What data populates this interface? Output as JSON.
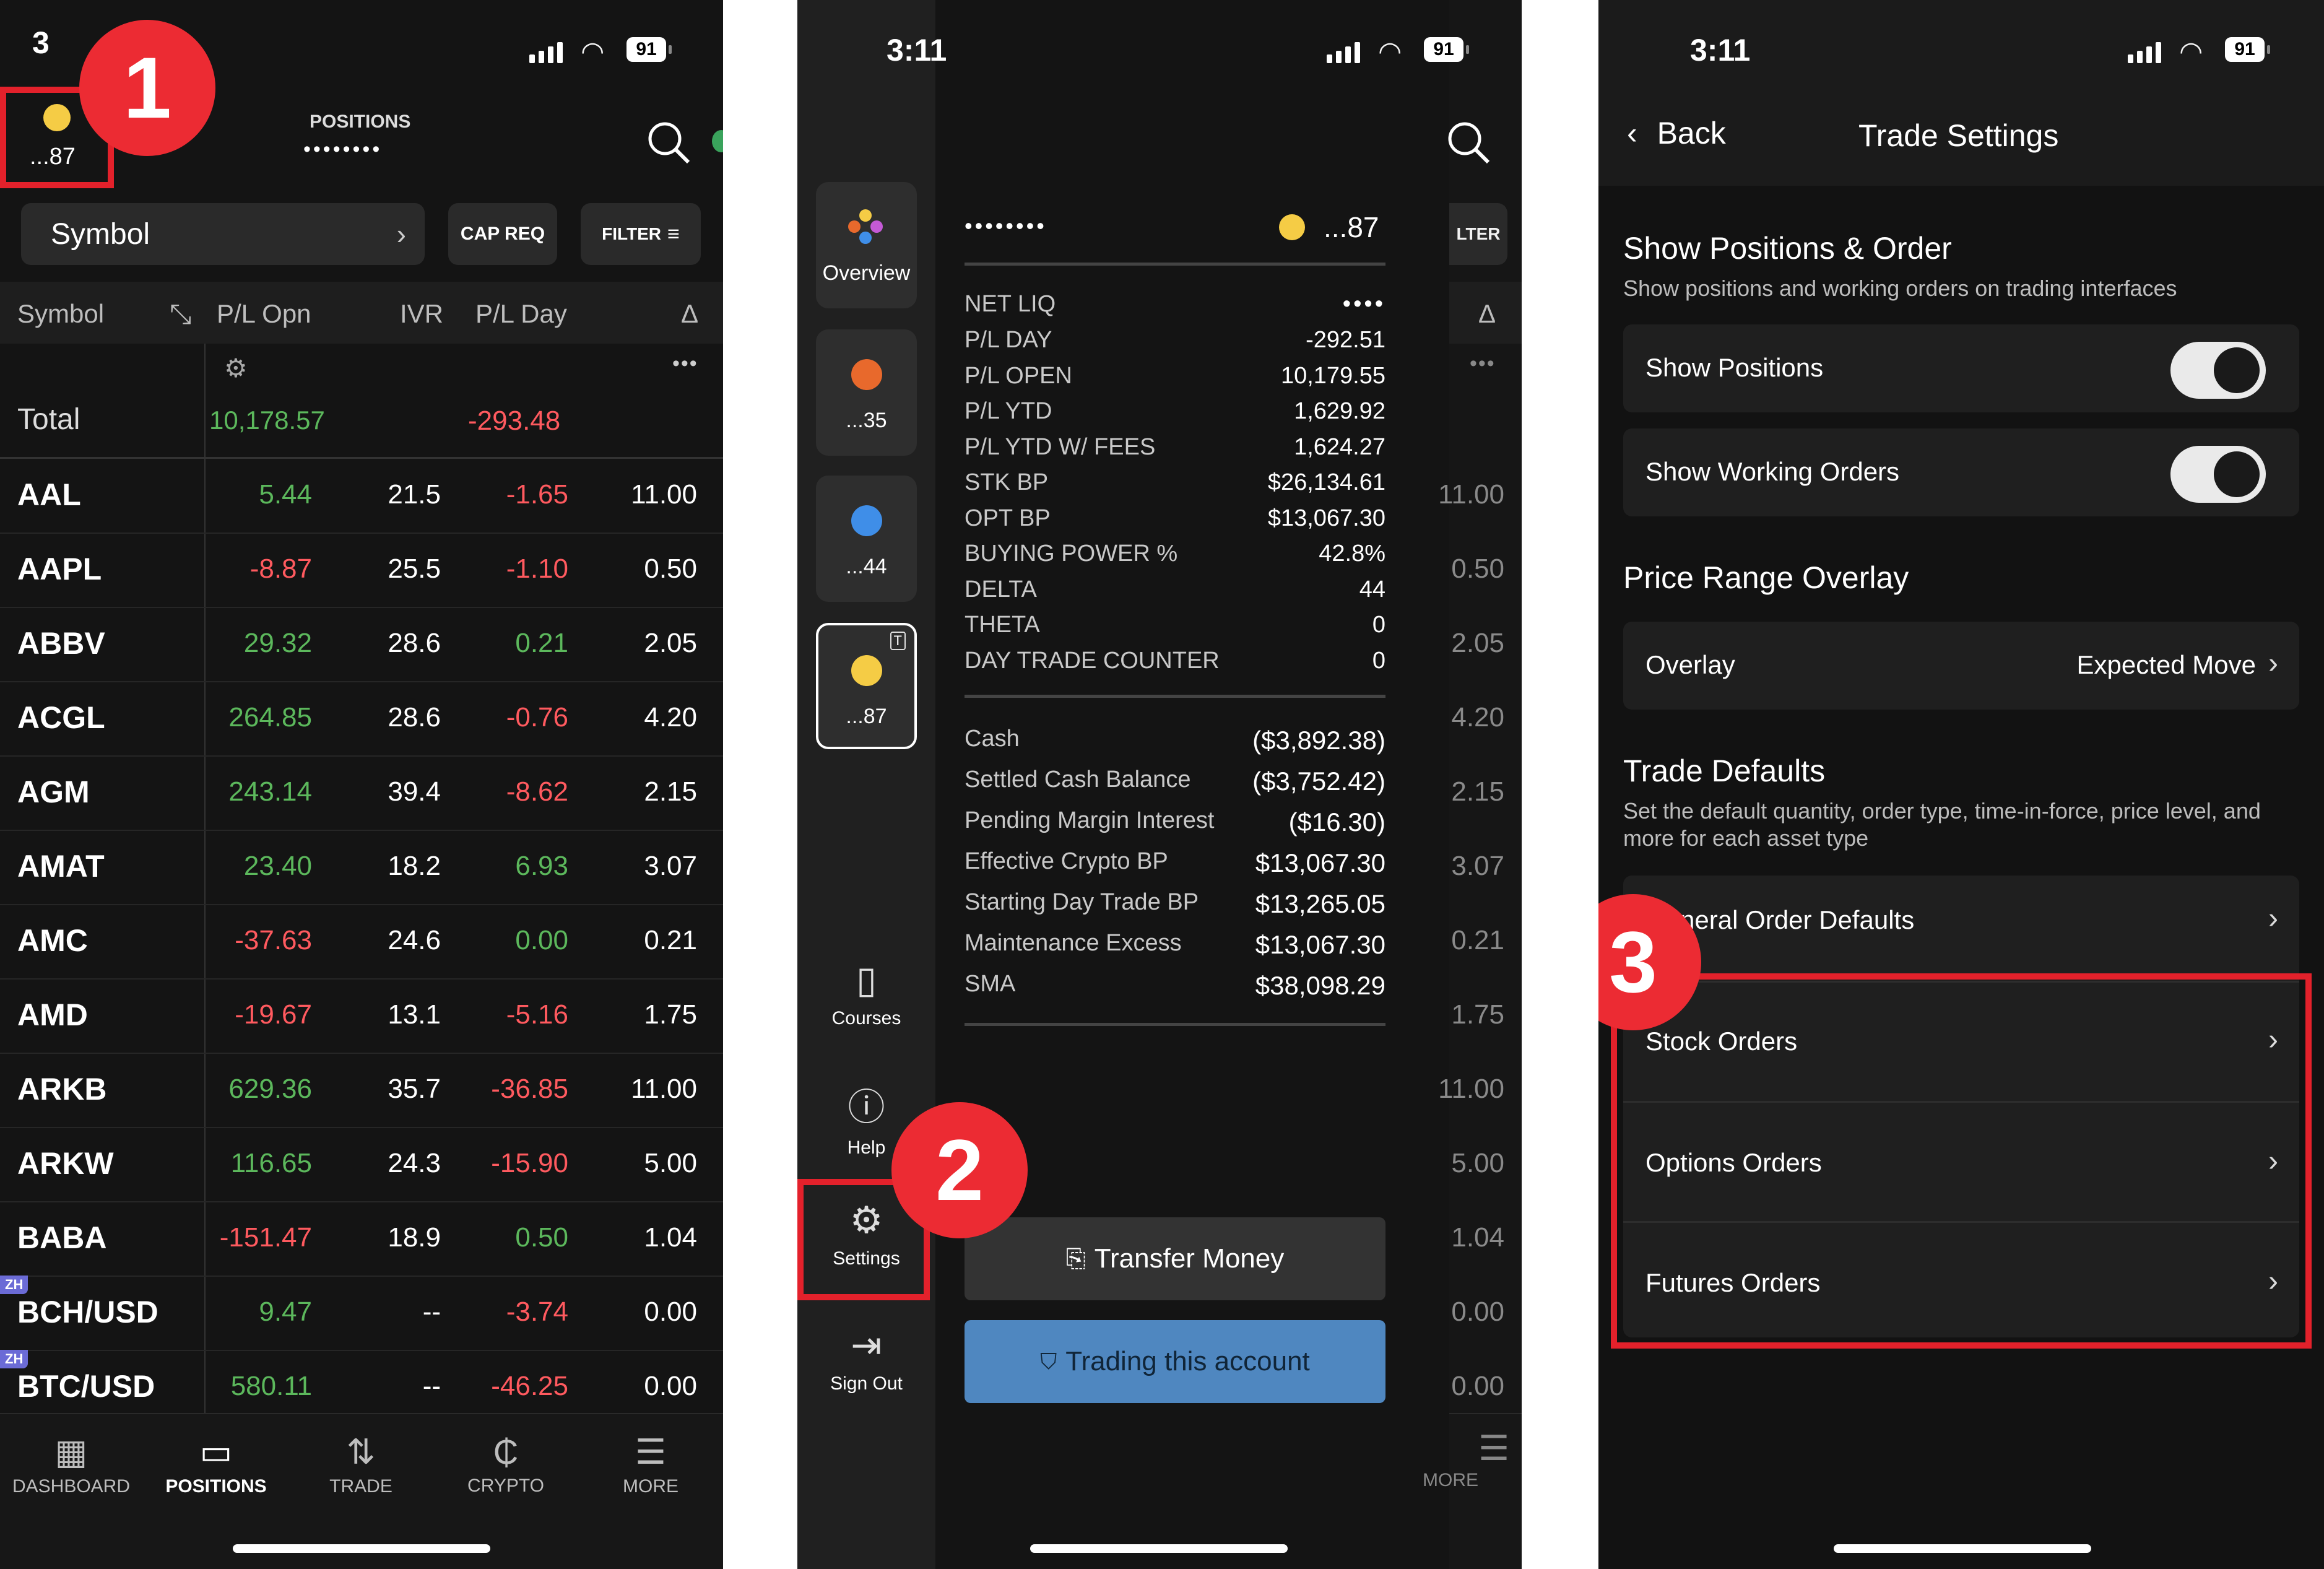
{
  "colors": {
    "positive": "#5cb85c",
    "negative": "#ff5a5f",
    "highlight": "#e3212b",
    "trade_button": "#4f87c0"
  },
  "status": {
    "time": "3:11",
    "battery": "91"
  },
  "screen1": {
    "account_label": "...87",
    "positions_title": "POSITIONS",
    "positions_masked": "••••••••",
    "symbol_dropdown": "Symbol",
    "cap_req": "CAP REQ",
    "filter": "FILTER",
    "columns": [
      "Symbol",
      "P/L Opn",
      "IVR",
      "P/L Day",
      "Δ"
    ],
    "total_label": "Total",
    "total_pl_open": "10,178.57",
    "total_pl_day": "-293.48",
    "rows": [
      {
        "symbol": "AAL",
        "pl_open": "5.44",
        "ivr": "21.5",
        "pl_day": "-1.65",
        "delta": "11.00",
        "zh": ""
      },
      {
        "symbol": "AAPL",
        "pl_open": "-8.87",
        "ivr": "25.5",
        "pl_day": "-1.10",
        "delta": "0.50",
        "zh": ""
      },
      {
        "symbol": "ABBV",
        "pl_open": "29.32",
        "ivr": "28.6",
        "pl_day": "0.21",
        "delta": "2.05",
        "zh": ""
      },
      {
        "symbol": "ACGL",
        "pl_open": "264.85",
        "ivr": "28.6",
        "pl_day": "-0.76",
        "delta": "4.20",
        "zh": ""
      },
      {
        "symbol": "AGM",
        "pl_open": "243.14",
        "ivr": "39.4",
        "pl_day": "-8.62",
        "delta": "2.15",
        "zh": ""
      },
      {
        "symbol": "AMAT",
        "pl_open": "23.40",
        "ivr": "18.2",
        "pl_day": "6.93",
        "delta": "3.07",
        "zh": ""
      },
      {
        "symbol": "AMC",
        "pl_open": "-37.63",
        "ivr": "24.6",
        "pl_day": "0.00",
        "delta": "0.21",
        "zh": ""
      },
      {
        "symbol": "AMD",
        "pl_open": "-19.67",
        "ivr": "13.1",
        "pl_day": "-5.16",
        "delta": "1.75",
        "zh": ""
      },
      {
        "symbol": "ARKB",
        "pl_open": "629.36",
        "ivr": "35.7",
        "pl_day": "-36.85",
        "delta": "11.00",
        "zh": ""
      },
      {
        "symbol": "ARKW",
        "pl_open": "116.65",
        "ivr": "24.3",
        "pl_day": "-15.90",
        "delta": "5.00",
        "zh": ""
      },
      {
        "symbol": "BABA",
        "pl_open": "-151.47",
        "ivr": "18.9",
        "pl_day": "0.50",
        "delta": "1.04",
        "zh": ""
      },
      {
        "symbol": "BCH/USD",
        "pl_open": "9.47",
        "ivr": "--",
        "pl_day": "-3.74",
        "delta": "0.00",
        "zh": "ZH"
      },
      {
        "symbol": "BTC/USD",
        "pl_open": "580.11",
        "ivr": "--",
        "pl_day": "-46.25",
        "delta": "0.00",
        "zh": "ZH"
      }
    ],
    "tabs": [
      "DASHBOARD",
      "POSITIONS",
      "TRADE",
      "CRYPTO",
      "MORE"
    ],
    "step": "1"
  },
  "screen2": {
    "accounts": [
      {
        "label": "Overview"
      },
      {
        "label": "...35",
        "color": "#e8692c"
      },
      {
        "label": "...44",
        "color": "#3f8ee8"
      },
      {
        "label": "...87",
        "color": "#f5cc45"
      }
    ],
    "rail": [
      "Courses",
      "Help",
      "Settings",
      "Sign Out"
    ],
    "account_masked": "••••••••",
    "account_label": "...87",
    "net_liq_label": "NET LIQ",
    "net_liq_value": "••••",
    "metrics": [
      {
        "label": "P/L DAY",
        "value": "-292.51",
        "tone": "neg"
      },
      {
        "label": "P/L OPEN",
        "value": "10,179.55",
        "tone": "pos"
      },
      {
        "label": "P/L YTD",
        "value": "1,629.92",
        "tone": "pos"
      },
      {
        "label": "P/L YTD W/ FEES",
        "value": "1,624.27",
        "tone": "pos"
      },
      {
        "label": "STK BP",
        "value": "$26,134.61",
        "tone": ""
      },
      {
        "label": "OPT BP",
        "value": "$13,067.30",
        "tone": ""
      },
      {
        "label": "BUYING POWER %",
        "value": "42.8%",
        "tone": ""
      },
      {
        "label": "DELTA",
        "value": "44",
        "tone": ""
      },
      {
        "label": "THETA",
        "value": "0",
        "tone": ""
      },
      {
        "label": "DAY TRADE COUNTER",
        "value": "0",
        "tone": ""
      }
    ],
    "balances": [
      {
        "label": "Cash",
        "value": "($3,892.38)"
      },
      {
        "label": "Settled Cash Balance",
        "value": "($3,752.42)"
      },
      {
        "label": "Pending Margin Interest",
        "value": "($16.30)"
      },
      {
        "label": "Effective Crypto BP",
        "value": "$13,067.30"
      },
      {
        "label": "Starting Day Trade BP",
        "value": "$13,265.05"
      },
      {
        "label": "Maintenance Excess",
        "value": "$13,067.30"
      },
      {
        "label": "SMA",
        "value": "$38,098.29"
      }
    ],
    "transfer_money": "Transfer Money",
    "trading_account": "Trading this account",
    "bg_filter": "LTER",
    "bg_delta": "Δ",
    "bg_more": "MORE",
    "bg_deltas": [
      "11.00",
      "0.50",
      "2.05",
      "4.20",
      "2.15",
      "3.07",
      "0.21",
      "1.75",
      "11.00",
      "5.00",
      "1.04",
      "0.00",
      "0.00"
    ],
    "step": "2"
  },
  "screen3": {
    "back": "Back",
    "title": "Trade Settings",
    "sec1_title": "Show Positions & Order",
    "sec1_sub": "Show positions and working orders on trading interfaces",
    "show_positions": "Show Positions",
    "show_working_orders": "Show Working Orders",
    "sec2_title": "Price Range Overlay",
    "overlay_label": "Overlay",
    "overlay_value": "Expected Move",
    "sec3_title": "Trade Defaults",
    "sec3_sub": "Set the default quantity, order type, time-in-force, price level, and more for each asset type",
    "general": "General Order Defaults",
    "stock": "Stock Orders",
    "options": "Options Orders",
    "futures": "Futures Orders",
    "step": "3"
  }
}
